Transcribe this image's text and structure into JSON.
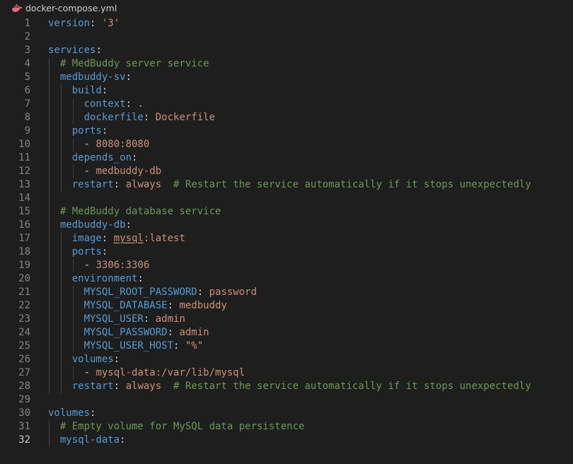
{
  "tab": {
    "filename": "docker-compose.yml",
    "icon": "docker-whale-icon",
    "icon_color": "#e06c75"
  },
  "colors": {
    "background": "#1e1e1e",
    "key": "#569cd6",
    "string": "#ce9178",
    "comment": "#6a9955",
    "punctuation": "#d4d4d4",
    "line_number": "#858585"
  },
  "active_line": 32,
  "lines": [
    {
      "n": "1",
      "tokens": [
        [
          "k",
          "version"
        ],
        [
          "p",
          ": "
        ],
        [
          "s",
          "'3'"
        ]
      ]
    },
    {
      "n": "2",
      "tokens": []
    },
    {
      "n": "3",
      "tokens": [
        [
          "k",
          "services"
        ],
        [
          "p",
          ":"
        ]
      ]
    },
    {
      "n": "4",
      "tokens": [
        [
          "p",
          "  "
        ],
        [
          "c",
          "# MedBuddy server service"
        ]
      ]
    },
    {
      "n": "5",
      "tokens": [
        [
          "p",
          "  "
        ],
        [
          "k",
          "medbuddy-sv"
        ],
        [
          "p",
          ":"
        ]
      ]
    },
    {
      "n": "6",
      "tokens": [
        [
          "p",
          "    "
        ],
        [
          "k",
          "build"
        ],
        [
          "p",
          ":"
        ]
      ]
    },
    {
      "n": "7",
      "tokens": [
        [
          "p",
          "      "
        ],
        [
          "k",
          "context"
        ],
        [
          "p",
          ": "
        ],
        [
          "s",
          "."
        ]
      ]
    },
    {
      "n": "8",
      "tokens": [
        [
          "p",
          "      "
        ],
        [
          "k",
          "dockerfile"
        ],
        [
          "p",
          ": "
        ],
        [
          "s",
          "Dockerfile"
        ]
      ]
    },
    {
      "n": "9",
      "tokens": [
        [
          "p",
          "    "
        ],
        [
          "k",
          "ports"
        ],
        [
          "p",
          ":"
        ]
      ]
    },
    {
      "n": "10",
      "tokens": [
        [
          "p",
          "      - "
        ],
        [
          "s",
          "8080:8080"
        ]
      ]
    },
    {
      "n": "11",
      "tokens": [
        [
          "p",
          "    "
        ],
        [
          "k",
          "depends_on"
        ],
        [
          "p",
          ":"
        ]
      ]
    },
    {
      "n": "12",
      "tokens": [
        [
          "p",
          "      - "
        ],
        [
          "s",
          "medbuddy-db"
        ]
      ]
    },
    {
      "n": "13",
      "tokens": [
        [
          "p",
          "    "
        ],
        [
          "k",
          "restart"
        ],
        [
          "p",
          ": "
        ],
        [
          "s",
          "always"
        ],
        [
          "p",
          "  "
        ],
        [
          "c",
          "# Restart the service automatically if it stops unexpectedly"
        ]
      ]
    },
    {
      "n": "14",
      "tokens": []
    },
    {
      "n": "15",
      "tokens": [
        [
          "p",
          "  "
        ],
        [
          "c",
          "# MedBuddy database service"
        ]
      ]
    },
    {
      "n": "16",
      "tokens": [
        [
          "p",
          "  "
        ],
        [
          "k",
          "medbuddy-db"
        ],
        [
          "p",
          ":"
        ]
      ]
    },
    {
      "n": "17",
      "tokens": [
        [
          "p",
          "    "
        ],
        [
          "k",
          "image"
        ],
        [
          "p",
          ": "
        ],
        [
          "su",
          "mysql"
        ],
        [
          "s",
          ":latest"
        ]
      ]
    },
    {
      "n": "18",
      "tokens": [
        [
          "p",
          "    "
        ],
        [
          "k",
          "ports"
        ],
        [
          "p",
          ":"
        ]
      ]
    },
    {
      "n": "19",
      "tokens": [
        [
          "p",
          "      - "
        ],
        [
          "s",
          "3306:3306"
        ]
      ]
    },
    {
      "n": "20",
      "tokens": [
        [
          "p",
          "    "
        ],
        [
          "k",
          "environment"
        ],
        [
          "p",
          ":"
        ]
      ]
    },
    {
      "n": "21",
      "tokens": [
        [
          "p",
          "      "
        ],
        [
          "k",
          "MYSQL_ROOT_PASSWORD"
        ],
        [
          "p",
          ": "
        ],
        [
          "s",
          "password"
        ]
      ]
    },
    {
      "n": "22",
      "tokens": [
        [
          "p",
          "      "
        ],
        [
          "k",
          "MYSQL_DATABASE"
        ],
        [
          "p",
          ": "
        ],
        [
          "s",
          "medbuddy"
        ]
      ]
    },
    {
      "n": "23",
      "tokens": [
        [
          "p",
          "      "
        ],
        [
          "k",
          "MYSQL_USER"
        ],
        [
          "p",
          ": "
        ],
        [
          "s",
          "admin"
        ]
      ]
    },
    {
      "n": "24",
      "tokens": [
        [
          "p",
          "      "
        ],
        [
          "k",
          "MYSQL_PASSWORD"
        ],
        [
          "p",
          ": "
        ],
        [
          "s",
          "admin"
        ]
      ]
    },
    {
      "n": "25",
      "tokens": [
        [
          "p",
          "      "
        ],
        [
          "k",
          "MYSQL_USER_HOST"
        ],
        [
          "p",
          ": "
        ],
        [
          "s",
          "\"%\""
        ]
      ]
    },
    {
      "n": "26",
      "tokens": [
        [
          "p",
          "    "
        ],
        [
          "k",
          "volumes"
        ],
        [
          "p",
          ":"
        ]
      ]
    },
    {
      "n": "27",
      "tokens": [
        [
          "p",
          "      - "
        ],
        [
          "s",
          "mysql-data:/var/lib/mysql"
        ]
      ]
    },
    {
      "n": "28",
      "tokens": [
        [
          "p",
          "    "
        ],
        [
          "k",
          "restart"
        ],
        [
          "p",
          ": "
        ],
        [
          "s",
          "always"
        ],
        [
          "p",
          "  "
        ],
        [
          "c",
          "# Restart the service automatically if it stops unexpectedly"
        ]
      ]
    },
    {
      "n": "29",
      "tokens": []
    },
    {
      "n": "30",
      "tokens": [
        [
          "k",
          "volumes"
        ],
        [
          "p",
          ":"
        ]
      ]
    },
    {
      "n": "31",
      "tokens": [
        [
          "p",
          "  "
        ],
        [
          "c",
          "# Empty volume for MySQL data persistence"
        ]
      ]
    },
    {
      "n": "32",
      "tokens": [
        [
          "p",
          "  "
        ],
        [
          "k",
          "mysql-data"
        ],
        [
          "p",
          ":"
        ]
      ]
    }
  ]
}
